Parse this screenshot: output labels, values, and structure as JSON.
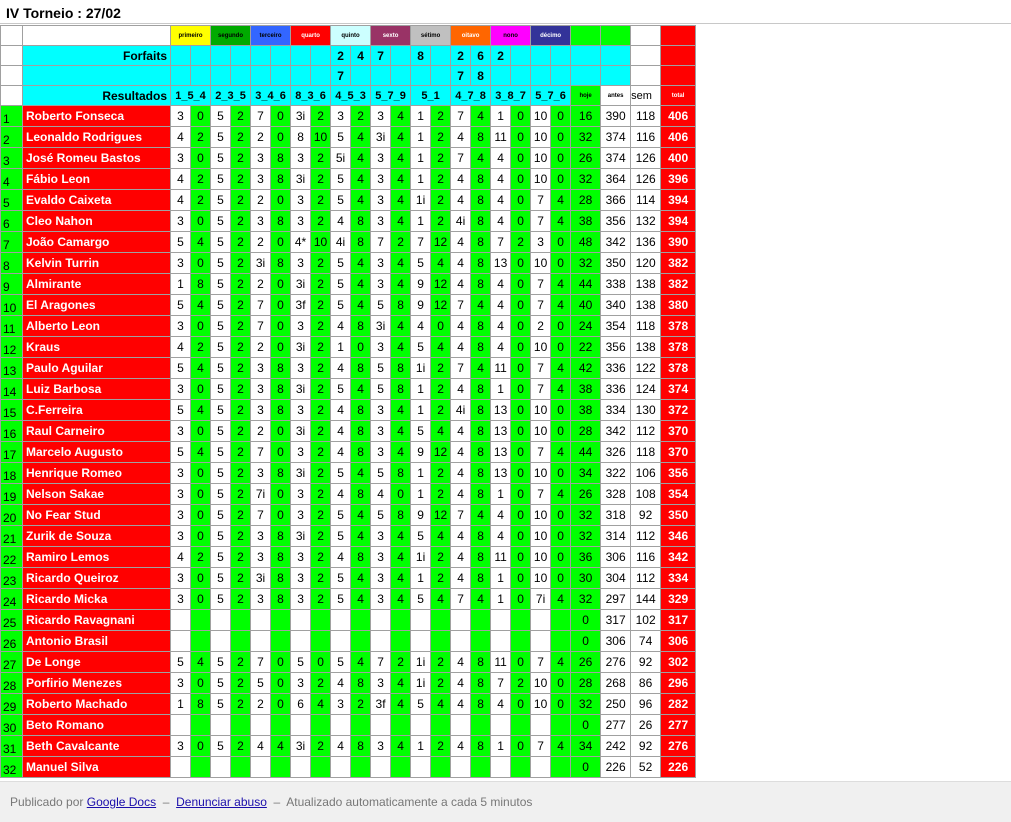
{
  "title": "IV Torneio : 27/02",
  "rounds": [
    {
      "name": "primeiro",
      "color": "#ffff00",
      "text": "#000000"
    },
    {
      "name": "segundo",
      "color": "#00aa00",
      "text": "#000000"
    },
    {
      "name": "terceiro",
      "color": "#3366ff",
      "text": "#000000"
    },
    {
      "name": "quarto",
      "color": "#ff0000",
      "text": "#ffffff"
    },
    {
      "name": "quinto",
      "color": "#ccffff",
      "text": "#000000"
    },
    {
      "name": "sexto",
      "color": "#993366",
      "text": "#ffffff"
    },
    {
      "name": "sétimo",
      "color": "#c0c0c0",
      "text": "#000000"
    },
    {
      "name": "oitavo",
      "color": "#ff6600",
      "text": "#ffffff"
    },
    {
      "name": "nono",
      "color": "#ff00ff",
      "text": "#000000"
    },
    {
      "name": "décimo",
      "color": "#333399",
      "text": "#ffffff"
    }
  ],
  "forfaits_label": "Forfaits",
  "forfaits_row1": [
    "",
    "",
    "",
    "",
    "",
    "",
    "",
    "",
    "2",
    "4",
    "7",
    "",
    "8",
    "",
    "2",
    "6",
    "2",
    "",
    "",
    "",
    "",
    "",
    "",
    ""
  ],
  "forfaits_row2": [
    "",
    "",
    "",
    "",
    "",
    "",
    "",
    "",
    "7",
    "",
    "",
    "",
    "",
    "",
    "7",
    "8",
    "",
    "",
    "",
    "",
    "",
    "",
    "",
    ""
  ],
  "resultados_label": "Resultados",
  "column_heads": [
    "1",
    "5",
    "4",
    "2",
    "3",
    "5",
    "3",
    "4",
    "6",
    "8",
    "3",
    "6",
    "4",
    "5",
    "3",
    "5",
    "7",
    "9",
    "5",
    "1",
    "4",
    "7",
    "8",
    "3",
    "8",
    "7",
    "5",
    "7",
    "6"
  ],
  "round_pairs": [
    "1_5_4",
    "2_3_5",
    "3_4_6",
    "8_3_6",
    "4_5_3",
    "5_7_9",
    "5_1",
    "4_7_8",
    "3_8_7",
    "5_7_6"
  ],
  "summary_heads": {
    "hoje": "hoje",
    "antes": "antes",
    "sem": "sem",
    "total": "total"
  },
  "players": [
    {
      "n": "1",
      "name": "Roberto Fonseca",
      "s": [
        "3",
        "0",
        "5",
        "2",
        "7",
        "0",
        "3i",
        "2",
        "3",
        "2",
        "3",
        "4",
        "1",
        "2",
        "7",
        "4",
        "1",
        "0",
        "10",
        "0"
      ],
      "hoje": "16",
      "antes": "390",
      "sem": "118",
      "total": "406"
    },
    {
      "n": "2",
      "name": "Leonaldo Rodrigues",
      "s": [
        "4",
        "2",
        "5",
        "2",
        "2",
        "0",
        "8",
        "10",
        "5",
        "4",
        "3i",
        "4",
        "1",
        "2",
        "4",
        "8",
        "11",
        "0",
        "10",
        "0"
      ],
      "hoje": "32",
      "antes": "374",
      "sem": "116",
      "total": "406"
    },
    {
      "n": "3",
      "name": "José Romeu Bastos",
      "s": [
        "3",
        "0",
        "5",
        "2",
        "3",
        "8",
        "3",
        "2",
        "5i",
        "4",
        "3",
        "4",
        "1",
        "2",
        "7",
        "4",
        "4",
        "0",
        "10",
        "0"
      ],
      "hoje": "26",
      "antes": "374",
      "sem": "126",
      "total": "400"
    },
    {
      "n": "4",
      "name": "Fábio Leon",
      "s": [
        "4",
        "2",
        "5",
        "2",
        "3",
        "8",
        "3i",
        "2",
        "5",
        "4",
        "3",
        "4",
        "1",
        "2",
        "4",
        "8",
        "4",
        "0",
        "10",
        "0"
      ],
      "hoje": "32",
      "antes": "364",
      "sem": "126",
      "total": "396"
    },
    {
      "n": "5",
      "name": "Evaldo Caixeta",
      "s": [
        "4",
        "2",
        "5",
        "2",
        "2",
        "0",
        "3",
        "2",
        "5",
        "4",
        "3",
        "4",
        "1i",
        "2",
        "4",
        "8",
        "4",
        "0",
        "7",
        "4"
      ],
      "hoje": "28",
      "antes": "366",
      "sem": "114",
      "total": "394"
    },
    {
      "n": "6",
      "name": "Cleo Nahon",
      "s": [
        "3",
        "0",
        "5",
        "2",
        "3",
        "8",
        "3",
        "2",
        "4",
        "8",
        "3",
        "4",
        "1",
        "2",
        "4i",
        "8",
        "4",
        "0",
        "7",
        "4"
      ],
      "hoje": "38",
      "antes": "356",
      "sem": "132",
      "total": "394"
    },
    {
      "n": "7",
      "name": "João Camargo",
      "s": [
        "5",
        "4",
        "5",
        "2",
        "2",
        "0",
        "4*",
        "10",
        "4i",
        "8",
        "7",
        "2",
        "7",
        "12",
        "4",
        "8",
        "7",
        "2",
        "3",
        "0"
      ],
      "hoje": "48",
      "antes": "342",
      "sem": "136",
      "total": "390"
    },
    {
      "n": "8",
      "name": "Kelvin Turrin",
      "s": [
        "3",
        "0",
        "5",
        "2",
        "3i",
        "8",
        "3",
        "2",
        "5",
        "4",
        "3",
        "4",
        "5",
        "4",
        "4",
        "8",
        "13",
        "0",
        "10",
        "0"
      ],
      "hoje": "32",
      "antes": "350",
      "sem": "120",
      "total": "382"
    },
    {
      "n": "9",
      "name": "Almirante",
      "s": [
        "1",
        "8",
        "5",
        "2",
        "2",
        "0",
        "3i",
        "2",
        "5",
        "4",
        "3",
        "4",
        "9",
        "12",
        "4",
        "8",
        "4",
        "0",
        "7",
        "4"
      ],
      "hoje": "44",
      "antes": "338",
      "sem": "138",
      "total": "382"
    },
    {
      "n": "10",
      "name": "El Aragones",
      "s": [
        "5",
        "4",
        "5",
        "2",
        "7",
        "0",
        "3f",
        "2",
        "5",
        "4",
        "5",
        "8",
        "9",
        "12",
        "7",
        "4",
        "4",
        "0",
        "7",
        "4"
      ],
      "hoje": "40",
      "antes": "340",
      "sem": "138",
      "total": "380"
    },
    {
      "n": "11",
      "name": "Alberto Leon",
      "s": [
        "3",
        "0",
        "5",
        "2",
        "7",
        "0",
        "3",
        "2",
        "4",
        "8",
        "3i",
        "4",
        "4",
        "0",
        "4",
        "8",
        "4",
        "0",
        "2",
        "0"
      ],
      "hoje": "24",
      "antes": "354",
      "sem": "118",
      "total": "378"
    },
    {
      "n": "12",
      "name": "Kraus",
      "s": [
        "4",
        "2",
        "5",
        "2",
        "2",
        "0",
        "3i",
        "2",
        "1",
        "0",
        "3",
        "4",
        "5",
        "4",
        "4",
        "8",
        "4",
        "0",
        "10",
        "0"
      ],
      "hoje": "22",
      "antes": "356",
      "sem": "138",
      "total": "378"
    },
    {
      "n": "13",
      "name": "Paulo Aguilar",
      "s": [
        "5",
        "4",
        "5",
        "2",
        "3",
        "8",
        "3",
        "2",
        "4",
        "8",
        "5",
        "8",
        "1i",
        "2",
        "7",
        "4",
        "11",
        "0",
        "7",
        "4"
      ],
      "hoje": "42",
      "antes": "336",
      "sem": "122",
      "total": "378"
    },
    {
      "n": "14",
      "name": "Luiz Barbosa",
      "s": [
        "3",
        "0",
        "5",
        "2",
        "3",
        "8",
        "3i",
        "2",
        "5",
        "4",
        "5",
        "8",
        "1",
        "2",
        "4",
        "8",
        "1",
        "0",
        "7",
        "4"
      ],
      "hoje": "38",
      "antes": "336",
      "sem": "124",
      "total": "374"
    },
    {
      "n": "15",
      "name": "C.Ferreira",
      "s": [
        "5",
        "4",
        "5",
        "2",
        "3",
        "8",
        "3",
        "2",
        "4",
        "8",
        "3",
        "4",
        "1",
        "2",
        "4i",
        "8",
        "13",
        "0",
        "10",
        "0"
      ],
      "hoje": "38",
      "antes": "334",
      "sem": "130",
      "total": "372"
    },
    {
      "n": "16",
      "name": "Raul Carneiro",
      "s": [
        "3",
        "0",
        "5",
        "2",
        "2",
        "0",
        "3i",
        "2",
        "4",
        "8",
        "3",
        "4",
        "5",
        "4",
        "4",
        "8",
        "13",
        "0",
        "10",
        "0"
      ],
      "hoje": "28",
      "antes": "342",
      "sem": "112",
      "total": "370"
    },
    {
      "n": "17",
      "name": "Marcelo Augusto",
      "s": [
        "5",
        "4",
        "5",
        "2",
        "7",
        "0",
        "3",
        "2",
        "4",
        "8",
        "3",
        "4",
        "9",
        "12",
        "4",
        "8",
        "13",
        "0",
        "7",
        "4"
      ],
      "hoje": "44",
      "antes": "326",
      "sem": "118",
      "total": "370"
    },
    {
      "n": "18",
      "name": "Henrique Romeo",
      "s": [
        "3",
        "0",
        "5",
        "2",
        "3",
        "8",
        "3i",
        "2",
        "5",
        "4",
        "5",
        "8",
        "1",
        "2",
        "4",
        "8",
        "13",
        "0",
        "10",
        "0"
      ],
      "hoje": "34",
      "antes": "322",
      "sem": "106",
      "total": "356"
    },
    {
      "n": "19",
      "name": "Nelson Sakae",
      "s": [
        "3",
        "0",
        "5",
        "2",
        "7i",
        "0",
        "3",
        "2",
        "4",
        "8",
        "4",
        "0",
        "1",
        "2",
        "4",
        "8",
        "1",
        "0",
        "7",
        "4"
      ],
      "hoje": "26",
      "antes": "328",
      "sem": "108",
      "total": "354"
    },
    {
      "n": "20",
      "name": "No Fear Stud",
      "s": [
        "3",
        "0",
        "5",
        "2",
        "7",
        "0",
        "3",
        "2",
        "5",
        "4",
        "5",
        "8",
        "9",
        "12",
        "7",
        "4",
        "4",
        "0",
        "10",
        "0"
      ],
      "hoje": "32",
      "antes": "318",
      "sem": "92",
      "total": "350"
    },
    {
      "n": "21",
      "name": "Zurik de Souza",
      "s": [
        "3",
        "0",
        "5",
        "2",
        "3",
        "8",
        "3i",
        "2",
        "5",
        "4",
        "3",
        "4",
        "5",
        "4",
        "4",
        "8",
        "4",
        "0",
        "10",
        "0"
      ],
      "hoje": "32",
      "antes": "314",
      "sem": "112",
      "total": "346"
    },
    {
      "n": "22",
      "name": "Ramiro Lemos",
      "s": [
        "4",
        "2",
        "5",
        "2",
        "3",
        "8",
        "3",
        "2",
        "4",
        "8",
        "3",
        "4",
        "1i",
        "2",
        "4",
        "8",
        "11",
        "0",
        "10",
        "0"
      ],
      "hoje": "36",
      "antes": "306",
      "sem": "116",
      "total": "342"
    },
    {
      "n": "23",
      "name": "Ricardo Queiroz",
      "s": [
        "3",
        "0",
        "5",
        "2",
        "3i",
        "8",
        "3",
        "2",
        "5",
        "4",
        "3",
        "4",
        "1",
        "2",
        "4",
        "8",
        "1",
        "0",
        "10",
        "0"
      ],
      "hoje": "30",
      "antes": "304",
      "sem": "112",
      "total": "334"
    },
    {
      "n": "24",
      "name": "Ricardo Micka",
      "s": [
        "3",
        "0",
        "5",
        "2",
        "3",
        "8",
        "3",
        "2",
        "5",
        "4",
        "3",
        "4",
        "5",
        "4",
        "7",
        "4",
        "1",
        "0",
        "7i",
        "4"
      ],
      "hoje": "32",
      "antes": "297",
      "sem": "144",
      "total": "329"
    },
    {
      "n": "25",
      "name": "Ricardo Ravagnani",
      "s": [
        "",
        "",
        "",
        "",
        "",
        "",
        "",
        "",
        "",
        "",
        "",
        "",
        "",
        "",
        "",
        "",
        "",
        "",
        "",
        ""
      ],
      "hoje": "0",
      "antes": "317",
      "sem": "102",
      "total": "317"
    },
    {
      "n": "26",
      "name": "Antonio Brasil",
      "s": [
        "",
        "",
        "",
        "",
        "",
        "",
        "",
        "",
        "",
        "",
        "",
        "",
        "",
        "",
        "",
        "",
        "",
        "",
        "",
        ""
      ],
      "hoje": "0",
      "antes": "306",
      "sem": "74",
      "total": "306"
    },
    {
      "n": "27",
      "name": "De Longe",
      "s": [
        "5",
        "4",
        "5",
        "2",
        "7",
        "0",
        "5",
        "0",
        "5",
        "4",
        "7",
        "2",
        "1i",
        "2",
        "4",
        "8",
        "11",
        "0",
        "7",
        "4"
      ],
      "hoje": "26",
      "antes": "276",
      "sem": "92",
      "total": "302"
    },
    {
      "n": "28",
      "name": "Porfirio Menezes",
      "s": [
        "3",
        "0",
        "5",
        "2",
        "5",
        "0",
        "3",
        "2",
        "4",
        "8",
        "3",
        "4",
        "1i",
        "2",
        "4",
        "8",
        "7",
        "2",
        "10",
        "0"
      ],
      "hoje": "28",
      "antes": "268",
      "sem": "86",
      "total": "296"
    },
    {
      "n": "29",
      "name": "Roberto Machado",
      "s": [
        "1",
        "8",
        "5",
        "2",
        "2",
        "0",
        "6",
        "4",
        "3",
        "2",
        "3f",
        "4",
        "5",
        "4",
        "4",
        "8",
        "4",
        "0",
        "10",
        "0"
      ],
      "hoje": "32",
      "antes": "250",
      "sem": "96",
      "total": "282"
    },
    {
      "n": "30",
      "name": "Beto Romano",
      "s": [
        "",
        "",
        "",
        "",
        "",
        "",
        "",
        "",
        "",
        "",
        "",
        "",
        "",
        "",
        "",
        "",
        "",
        "",
        "",
        ""
      ],
      "hoje": "0",
      "antes": "277",
      "sem": "26",
      "total": "277"
    },
    {
      "n": "31",
      "name": "Beth Cavalcante",
      "s": [
        "3",
        "0",
        "5",
        "2",
        "4",
        "4",
        "3i",
        "2",
        "4",
        "8",
        "3",
        "4",
        "1",
        "2",
        "4",
        "8",
        "1",
        "0",
        "7",
        "4"
      ],
      "hoje": "34",
      "antes": "242",
      "sem": "92",
      "total": "276"
    },
    {
      "n": "32",
      "name": "Manuel Silva",
      "s": [
        "",
        "",
        "",
        "",
        "",
        "",
        "",
        "",
        "",
        "",
        "",
        "",
        "",
        "",
        "",
        "",
        "",
        "",
        "",
        ""
      ],
      "hoje": "0",
      "antes": "226",
      "sem": "52",
      "total": "226"
    }
  ],
  "footer": {
    "prefix": "Publicado por",
    "docs_link": "Google Docs",
    "sep1": "–",
    "abuse_link": "Denunciar abuso",
    "sep2": "–",
    "auto": "Atualizado automaticamente a cada 5 minutos"
  }
}
